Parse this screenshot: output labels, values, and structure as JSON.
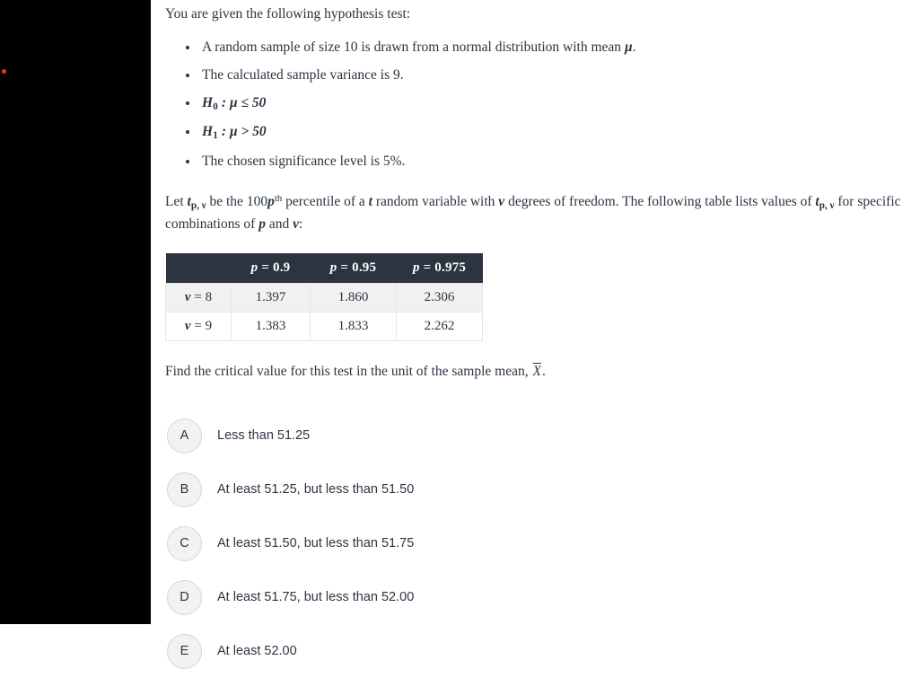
{
  "layout": {
    "rail_color": "#000000",
    "page_background": "#ffffff",
    "accent_dot_color": "#e8372e",
    "text_color": "#2a3542",
    "table_header_bg": "#2b3440",
    "table_row_shaded_bg": "#f1f1f1",
    "bubble_bg": "#f2f2f2"
  },
  "question": {
    "lead": "You are given the following hypothesis test:",
    "bullets": [
      {
        "id": "sample-size",
        "pre": "A random sample of size 10 is drawn from a normal distribution with mean ",
        "symbol": "μ",
        "post": "."
      },
      {
        "id": "sample-variance",
        "text": "The calculated sample variance is 9."
      },
      {
        "id": "null-hypothesis",
        "base": "H",
        "sub": "0",
        "relation": " : μ ≤ 50"
      },
      {
        "id": "alt-hypothesis",
        "base": "H",
        "sub": "1",
        "relation": " : μ > 50"
      },
      {
        "id": "significance-level",
        "text": "The chosen significance level is 5%."
      }
    ],
    "definition": {
      "part1": "Let ",
      "t_symbol": "t",
      "t_sub": "p, ν",
      "part2": " be the 100",
      "p_symbol": "p",
      "th": "th",
      "part3": " percentile of a ",
      "t_var": "t",
      "part4": " random variable with ",
      "nu_symbol": "ν",
      "part5": " degrees of freedom. The following table lists values of ",
      "t_symbol2": "t",
      "t_sub2": "p, ν",
      "part6": " for specific combinations of ",
      "p_symbol2": "p",
      "part7": " and ",
      "nu_symbol2": "ν",
      "part8": ":"
    },
    "prompt": {
      "part1": "Find the critical value for this test in the unit of the sample mean, ",
      "symbol": "X",
      "part2": "."
    }
  },
  "table": {
    "corner_label": "",
    "column_headers": [
      {
        "p_label": "p",
        "eq": " = ",
        "value": "0.9"
      },
      {
        "p_label": "p",
        "eq": " = ",
        "value": "0.95"
      },
      {
        "p_label": "p",
        "eq": " = ",
        "value": "0.975"
      }
    ],
    "rows": [
      {
        "header": {
          "nu_label": "ν",
          "eq": " = ",
          "value": "8"
        },
        "cells": [
          "1.397",
          "1.860",
          "2.306"
        ],
        "shaded": true
      },
      {
        "header": {
          "nu_label": "ν",
          "eq": " = ",
          "value": "9"
        },
        "cells": [
          "1.383",
          "1.833",
          "2.262"
        ],
        "shaded": false
      }
    ]
  },
  "choices": [
    {
      "letter": "A",
      "text": "Less than 51.25"
    },
    {
      "letter": "B",
      "text": "At least 51.25, but less than 51.50"
    },
    {
      "letter": "C",
      "text": "At least 51.50, but less than 51.75"
    },
    {
      "letter": "D",
      "text": "At least 51.75, but less than 52.00"
    },
    {
      "letter": "E",
      "text": "At least 52.00"
    }
  ]
}
